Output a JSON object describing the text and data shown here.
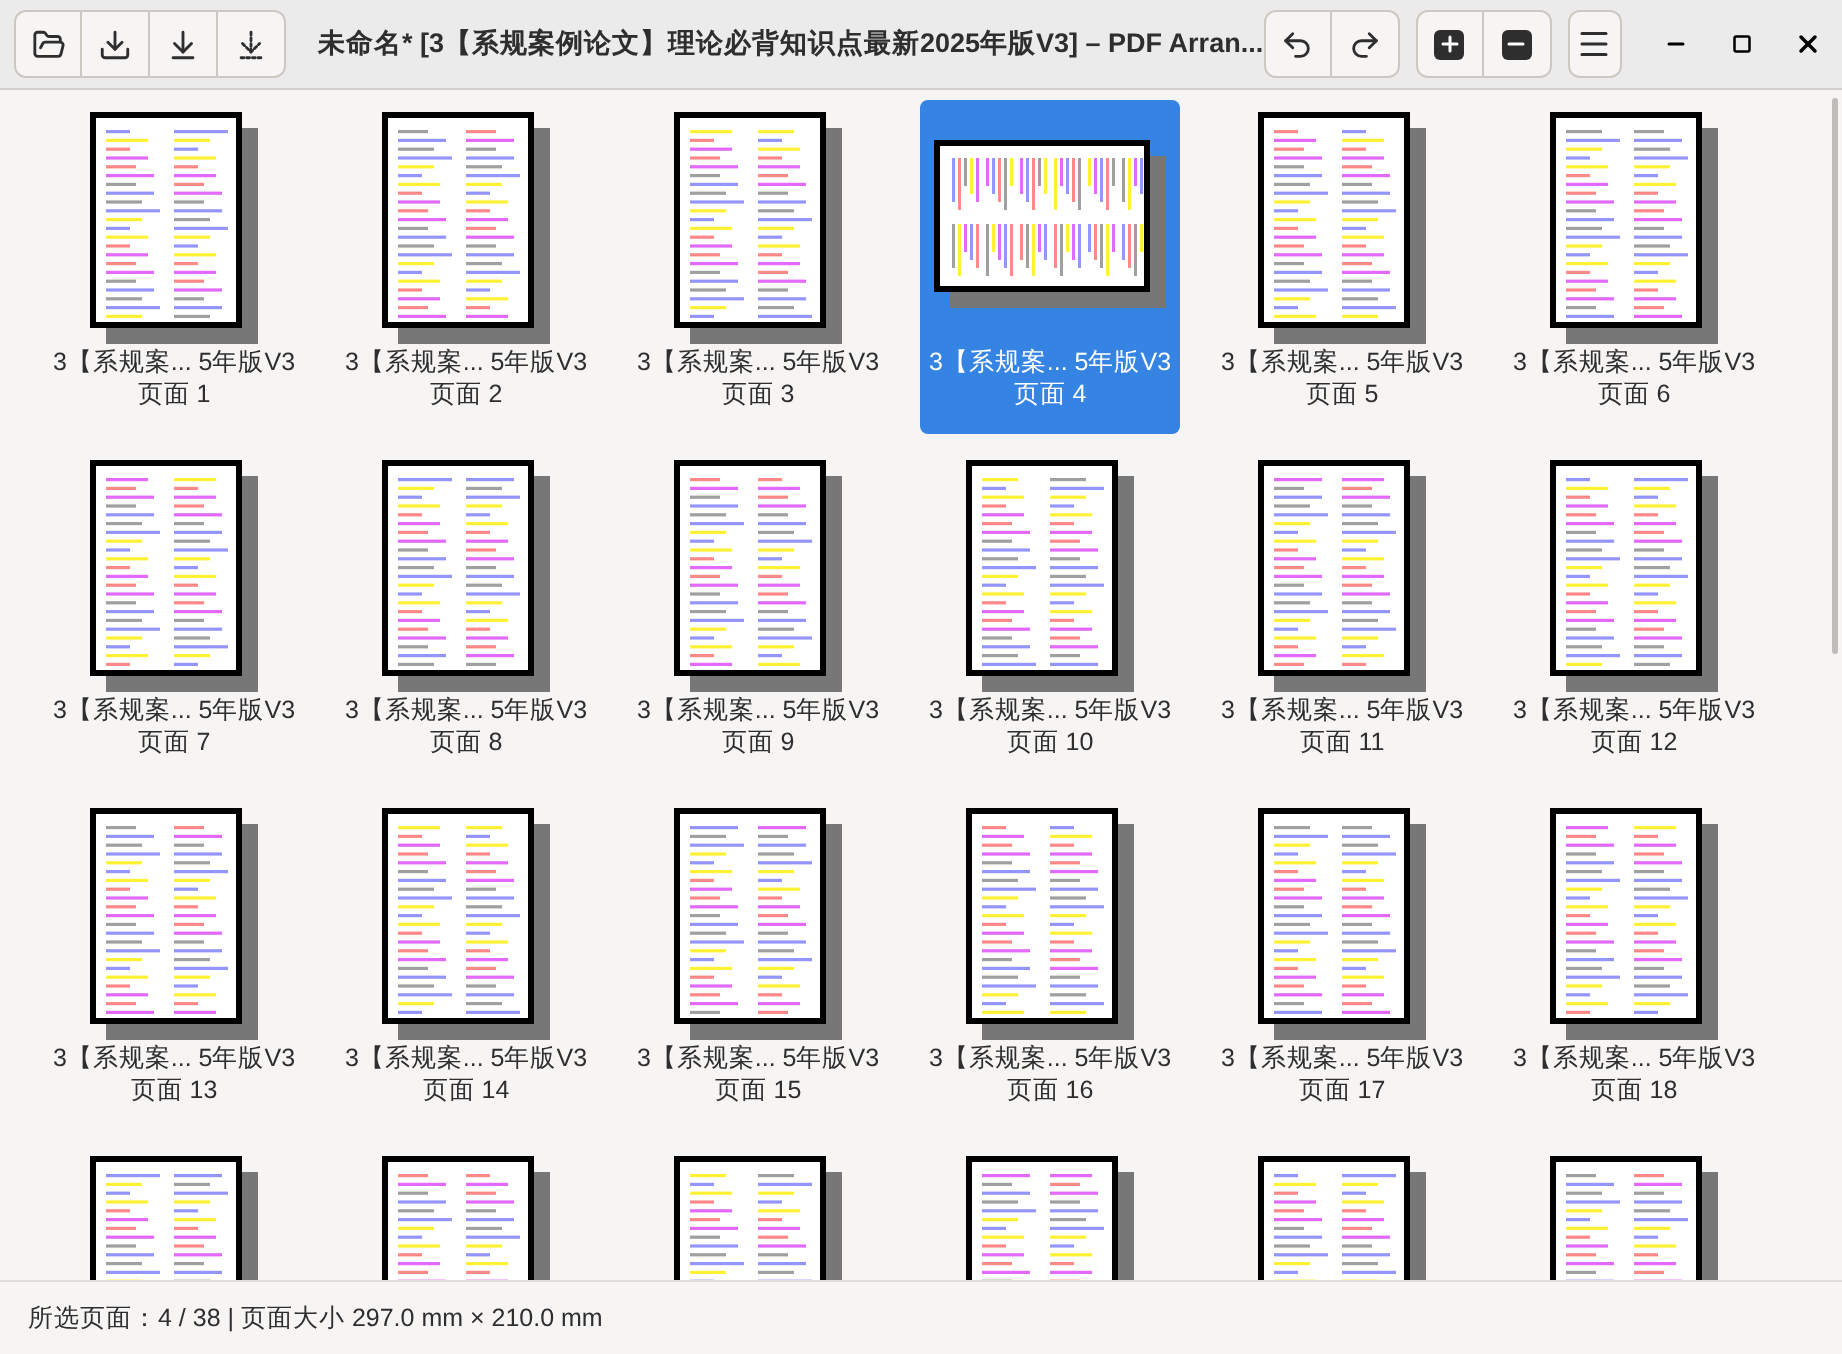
{
  "window": {
    "title": "未命名* [3【系规案例论文】理论必背知识点最新2025年版V3] – PDF Arran..."
  },
  "pages": [
    {
      "kind": "portrait",
      "selected": false,
      "lines": [
        "3【系规案... 5年版V3",
        "页面 1"
      ]
    },
    {
      "kind": "portrait",
      "selected": false,
      "lines": [
        "3【系规案... 5年版V3",
        "页面 2"
      ]
    },
    {
      "kind": "portrait",
      "selected": false,
      "lines": [
        "3【系规案... 5年版V3",
        "页面 3"
      ]
    },
    {
      "kind": "landscape",
      "selected": true,
      "lines": [
        "3【系规案... 5年版V3",
        "页面 4"
      ]
    },
    {
      "kind": "portrait",
      "selected": false,
      "lines": [
        "3【系规案... 5年版V3",
        "页面 5"
      ]
    },
    {
      "kind": "portrait",
      "selected": false,
      "lines": [
        "3【系规案... 5年版V3",
        "页面 6"
      ]
    },
    {
      "kind": "portrait",
      "selected": false,
      "lines": [
        "3【系规案... 5年版V3",
        "页面 7"
      ]
    },
    {
      "kind": "portrait",
      "selected": false,
      "lines": [
        "3【系规案... 5年版V3",
        "页面 8"
      ]
    },
    {
      "kind": "portrait",
      "selected": false,
      "lines": [
        "3【系规案... 5年版V3",
        "页面 9"
      ]
    },
    {
      "kind": "portrait",
      "selected": false,
      "lines": [
        "3【系规案... 5年版V3",
        "页面 10"
      ]
    },
    {
      "kind": "portrait",
      "selected": false,
      "lines": [
        "3【系规案... 5年版V3",
        "页面 11"
      ]
    },
    {
      "kind": "portrait",
      "selected": false,
      "lines": [
        "3【系规案... 5年版V3",
        "页面 12"
      ]
    },
    {
      "kind": "portrait",
      "selected": false,
      "lines": [
        "3【系规案... 5年版V3",
        "页面 13"
      ]
    },
    {
      "kind": "portrait",
      "selected": false,
      "lines": [
        "3【系规案... 5年版V3",
        "页面 14"
      ]
    },
    {
      "kind": "portrait",
      "selected": false,
      "lines": [
        "3【系规案... 5年版V3",
        "页面 15"
      ]
    },
    {
      "kind": "portrait",
      "selected": false,
      "lines": [
        "3【系规案... 5年版V3",
        "页面 16"
      ]
    },
    {
      "kind": "portrait",
      "selected": false,
      "lines": [
        "3【系规案... 5年版V3",
        "页面 17"
      ]
    },
    {
      "kind": "portrait",
      "selected": false,
      "lines": [
        "3【系规案... 5年版V3",
        "页面 18"
      ]
    },
    {
      "kind": "portrait",
      "selected": false
    },
    {
      "kind": "portrait",
      "selected": false
    },
    {
      "kind": "portrait",
      "selected": false
    },
    {
      "kind": "portrait",
      "selected": false
    },
    {
      "kind": "portrait",
      "selected": false
    },
    {
      "kind": "portrait",
      "selected": false
    }
  ],
  "status_bar": "所选页面：4 / 38 | 页面大小 297.0 mm × 210.0 mm"
}
